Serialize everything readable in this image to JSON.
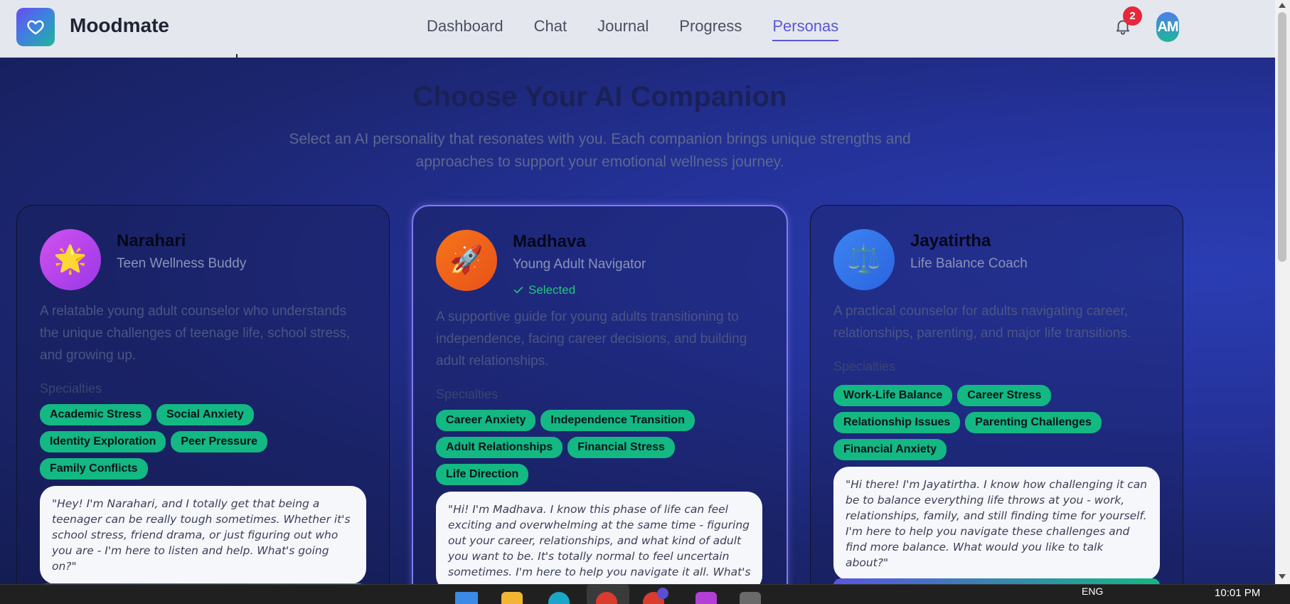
{
  "app": {
    "name": "Moodmate"
  },
  "nav": {
    "items": [
      {
        "label": "Dashboard",
        "active": false
      },
      {
        "label": "Chat",
        "active": false
      },
      {
        "label": "Journal",
        "active": false
      },
      {
        "label": "Progress",
        "active": false
      },
      {
        "label": "Personas",
        "active": true
      }
    ]
  },
  "header": {
    "notification_count": "2",
    "avatar_initials": "AM"
  },
  "page": {
    "title": "Choose Your AI Companion",
    "subtitle": "Select an AI personality that resonates with you. Each companion brings unique strengths and approaches to support your emotional wellness journey."
  },
  "specialties_label": "Specialties",
  "personas": [
    {
      "name": "Narahari",
      "role": "Teen Wellness Buddy",
      "icon": "star-icon",
      "glyph": "🌟",
      "selected": false,
      "description": "A relatable young adult counselor who understands the unique challenges of teenage life, school stress, and growing up.",
      "tags": [
        "Academic Stress",
        "Social Anxiety",
        "Identity Exploration",
        "Peer Pressure",
        "Family Conflicts"
      ],
      "quote": "\"Hey! I'm Narahari, and I totally get that being a teenager can be really tough sometimes. Whether it's school stress, friend drama, or just figuring out who you are - I'm here to listen and help. What's going on?\""
    },
    {
      "name": "Madhava",
      "role": "Young Adult Navigator",
      "icon": "rocket-icon",
      "glyph": "🚀",
      "selected": true,
      "selected_label": "Selected",
      "description": "A supportive guide for young adults transitioning to independence, facing career decisions, and building adult relationships.",
      "tags": [
        "Career Anxiety",
        "Independence Transition",
        "Adult Relationships",
        "Financial Stress",
        "Life Direction"
      ],
      "quote": "\"Hi! I'm Madhava. I know this phase of life can feel exciting and overwhelming at the same time - figuring out your career, relationships, and what kind of adult you want to be. It's totally normal to feel uncertain sometimes. I'm here to help you navigate it all. What's"
    },
    {
      "name": "Jayatirtha",
      "role": "Life Balance Coach",
      "icon": "balance-scale-icon",
      "glyph": "⚖️",
      "selected": false,
      "description": "A practical counselor for adults navigating career, relationships, parenting, and major life transitions.",
      "tags": [
        "Work-Life Balance",
        "Career Stress",
        "Relationship Issues",
        "Parenting Challenges",
        "Financial Anxiety"
      ],
      "quote": "\"Hi there! I'm Jayatirtha. I know how challenging it can be to balance everything life throws at you - work, relationships, family, and still finding time for yourself. I'm here to help you navigate these challenges and find more balance. What would you like to talk about?\""
    }
  ],
  "taskbar": {
    "language": "ENG",
    "time": "10:01 PM"
  },
  "colors": {
    "accent": "#5b57d6",
    "tag": "#13b883",
    "selected": "#21c57a"
  }
}
